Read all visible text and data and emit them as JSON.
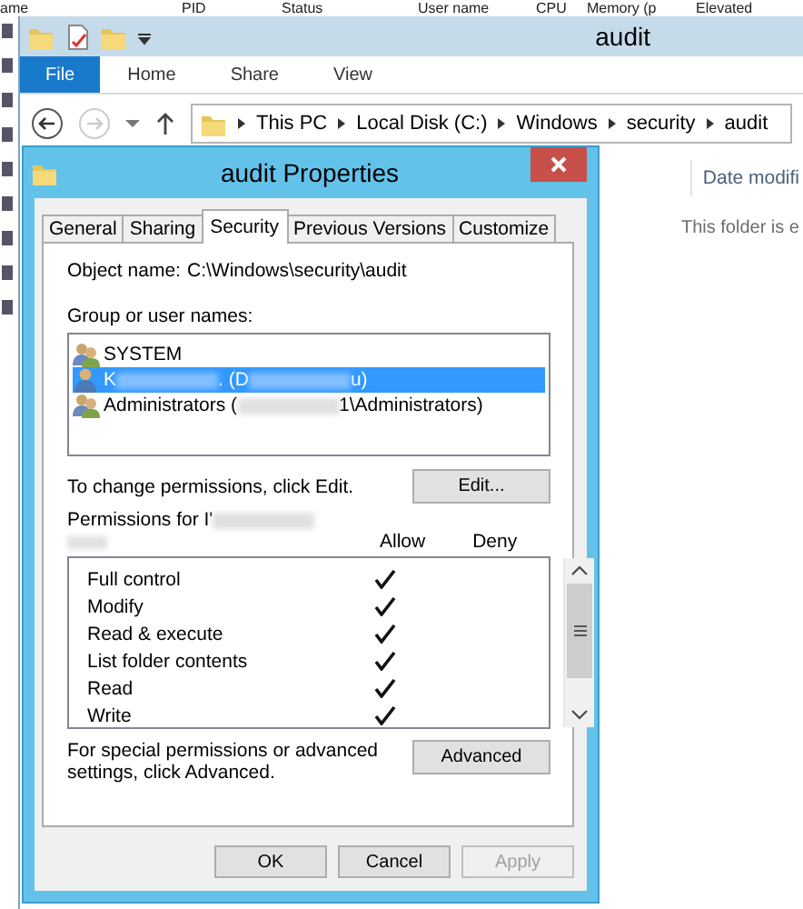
{
  "background_window": {
    "columns": [
      "ame",
      "PID",
      "Status",
      "User name",
      "CPU",
      "Memory (p",
      "Elevated"
    ]
  },
  "explorer": {
    "title": "audit",
    "ribbon_tabs": [
      {
        "label": "File",
        "selected": true
      },
      {
        "label": "Home",
        "selected": false
      },
      {
        "label": "Share",
        "selected": false
      },
      {
        "label": "View",
        "selected": false
      }
    ],
    "breadcrumb": [
      "This PC",
      "Local Disk (C:)",
      "Windows",
      "security",
      "audit"
    ],
    "column_header": "Date modifi",
    "empty_message": "This folder is e"
  },
  "dialog": {
    "title": "audit Properties",
    "tabs": [
      {
        "label": "General",
        "selected": false
      },
      {
        "label": "Sharing",
        "selected": false
      },
      {
        "label": "Security",
        "selected": true
      },
      {
        "label": "Previous Versions",
        "selected": false
      },
      {
        "label": "Customize",
        "selected": false
      }
    ],
    "object_name_label": "Object name:",
    "object_name": "C:\\Windows\\security\\audit",
    "group_label": "Group or user names:",
    "users": [
      {
        "kind": "group",
        "selected": false,
        "parts": [
          {
            "kind": "text",
            "text": "SYSTEM"
          }
        ]
      },
      {
        "kind": "user",
        "selected": true,
        "parts": [
          {
            "kind": "text",
            "text": "K"
          },
          {
            "kind": "redacted"
          },
          {
            "kind": "text",
            "text": ". (D"
          },
          {
            "kind": "redacted"
          },
          {
            "kind": "text",
            "text": "u)"
          }
        ]
      },
      {
        "kind": "group",
        "selected": false,
        "parts": [
          {
            "kind": "text",
            "text": "Administrators ("
          },
          {
            "kind": "redacted"
          },
          {
            "kind": "text",
            "text": "1\\Administrators)"
          }
        ]
      }
    ],
    "edit_hint": "To change permissions, click Edit.",
    "edit_button": "Edit...",
    "permissions_label": [
      {
        "kind": "text",
        "text": "Permissions for I'"
      },
      {
        "kind": "redacted"
      }
    ],
    "allow_header": "Allow",
    "deny_header": "Deny",
    "permissions": [
      {
        "name": "Full control",
        "allow": true
      },
      {
        "name": "Modify",
        "allow": true
      },
      {
        "name": "Read & execute",
        "allow": true
      },
      {
        "name": "List folder contents",
        "allow": true
      },
      {
        "name": "Read",
        "allow": true
      },
      {
        "name": "Write",
        "allow": true
      }
    ],
    "advanced_hint": "For special permissions or advanced settings, click Advanced.",
    "advanced_button": "Advanced",
    "buttons": [
      {
        "label": "OK",
        "disabled": false
      },
      {
        "label": "Cancel",
        "disabled": false
      },
      {
        "label": "Apply",
        "disabled": true
      }
    ]
  }
}
